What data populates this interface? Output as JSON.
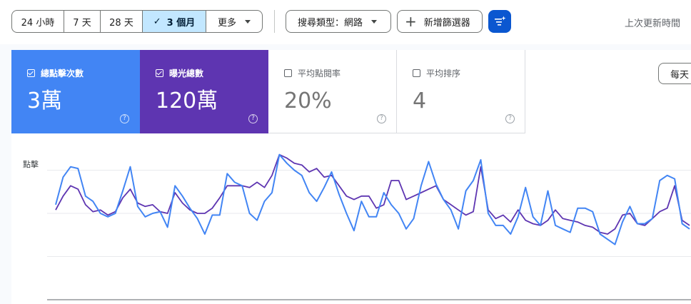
{
  "toolbar": {
    "ranges": [
      {
        "label": "24 小時",
        "active": false
      },
      {
        "label": "7 天",
        "active": false
      },
      {
        "label": "28 天",
        "active": false
      },
      {
        "label": "3 個月",
        "active": true
      },
      {
        "label": "更多",
        "active": false
      }
    ],
    "check_glyph": "✓",
    "search_type": "搜尋類型：網路",
    "add_filter": "新增篩選器",
    "filter_icon": "filter-sparkle-icon",
    "last_update": "上次更新時間"
  },
  "metrics": {
    "clicks": {
      "label": "總點擊次數",
      "value": "3萬",
      "checked": true,
      "color": "#4285f4"
    },
    "impressions": {
      "label": "曝光總數",
      "value": "120萬",
      "checked": true,
      "color": "#5e35b1"
    },
    "ctr": {
      "label": "平均點閱率",
      "value": "20%",
      "checked": false
    },
    "position": {
      "label": "平均排序",
      "value": "4",
      "checked": false
    },
    "help_glyph": "?"
  },
  "granularity_button": "每天",
  "chart_data": {
    "type": "line",
    "ylabel": "點擊",
    "grid": true,
    "ylim": [
      0,
      1
    ],
    "series": [
      {
        "color": "#4285f4",
        "values": [
          0.55,
          0.71,
          0.77,
          0.76,
          0.6,
          0.57,
          0.5,
          0.48,
          0.5,
          0.63,
          0.77,
          0.54,
          0.48,
          0.5,
          0.51,
          0.42,
          0.66,
          0.6,
          0.53,
          0.47,
          0.38,
          0.49,
          0.49,
          0.73,
          0.68,
          0.66,
          0.5,
          0.46,
          0.57,
          0.62,
          0.84,
          0.79,
          0.75,
          0.72,
          0.62,
          0.57,
          0.65,
          0.74,
          0.61,
          0.5,
          0.4,
          0.57,
          0.48,
          0.48,
          0.62,
          0.55,
          0.5,
          0.41,
          0.47,
          0.66,
          0.8,
          0.67,
          0.58,
          0.52,
          0.41,
          0.63,
          0.69,
          0.81,
          0.5,
          0.43,
          0.43,
          0.38,
          0.48,
          0.65,
          0.48,
          0.43,
          0.63,
          0.43,
          0.41,
          0.39,
          0.53,
          0.53,
          0.51,
          0.38,
          0.35,
          0.32,
          0.45,
          0.54,
          0.44,
          0.44,
          0.47,
          0.69,
          0.72,
          0.7,
          0.44,
          0.41
        ]
      },
      {
        "color": "#5e35b1",
        "values": [
          0.52,
          0.6,
          0.66,
          0.64,
          0.55,
          0.51,
          0.52,
          0.49,
          0.51,
          0.59,
          0.64,
          0.56,
          0.54,
          0.55,
          0.51,
          0.5,
          0.62,
          0.56,
          0.52,
          0.5,
          0.5,
          0.53,
          0.59,
          0.66,
          0.66,
          0.66,
          0.65,
          0.68,
          0.65,
          0.72,
          0.84,
          0.82,
          0.79,
          0.78,
          0.74,
          0.76,
          0.71,
          0.72,
          0.66,
          0.6,
          0.58,
          0.6,
          0.6,
          0.53,
          0.55,
          0.69,
          0.69,
          0.58,
          0.6,
          0.62,
          0.64,
          0.66,
          0.58,
          0.55,
          0.52,
          0.49,
          0.51,
          0.77,
          0.52,
          0.47,
          0.49,
          0.45,
          0.52,
          0.46,
          0.44,
          0.43,
          0.46,
          0.52,
          0.47,
          0.46,
          0.45,
          0.43,
          0.42,
          0.39,
          0.38,
          0.41,
          0.49,
          0.5,
          0.44,
          0.43,
          0.47,
          0.51,
          0.53,
          0.66,
          0.46,
          0.43
        ]
      }
    ]
  }
}
